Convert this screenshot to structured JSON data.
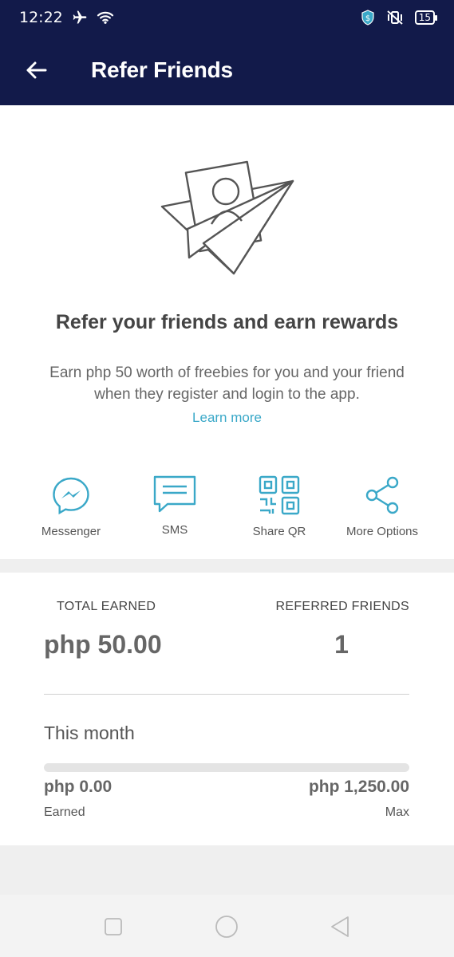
{
  "status_bar": {
    "time": "12:22",
    "battery": "15"
  },
  "header": {
    "title": "Refer Friends"
  },
  "hero": {
    "headline": "Refer your friends and earn rewards",
    "description": "Earn php 50 worth of freebies for you and your friend when they register and login to the app.",
    "learn_more": "Learn more"
  },
  "share_options": [
    {
      "label": "Messenger",
      "icon": "messenger-icon"
    },
    {
      "label": "SMS",
      "icon": "sms-icon"
    },
    {
      "label": "Share QR",
      "icon": "qr-code-icon"
    },
    {
      "label": "More Options",
      "icon": "share-icon"
    }
  ],
  "stats": {
    "total_earned_label": "TOTAL EARNED",
    "total_earned_value": "php 50.00",
    "referred_label": "REFERRED FRIENDS",
    "referred_value": "1"
  },
  "month": {
    "title": "This month",
    "progress": 0,
    "earned_value": "php 0.00",
    "earned_label": "Earned",
    "max_value": "php 1,250.00",
    "max_label": "Max"
  },
  "colors": {
    "header_bg": "#121a4a",
    "accent": "#3aa8c8"
  }
}
